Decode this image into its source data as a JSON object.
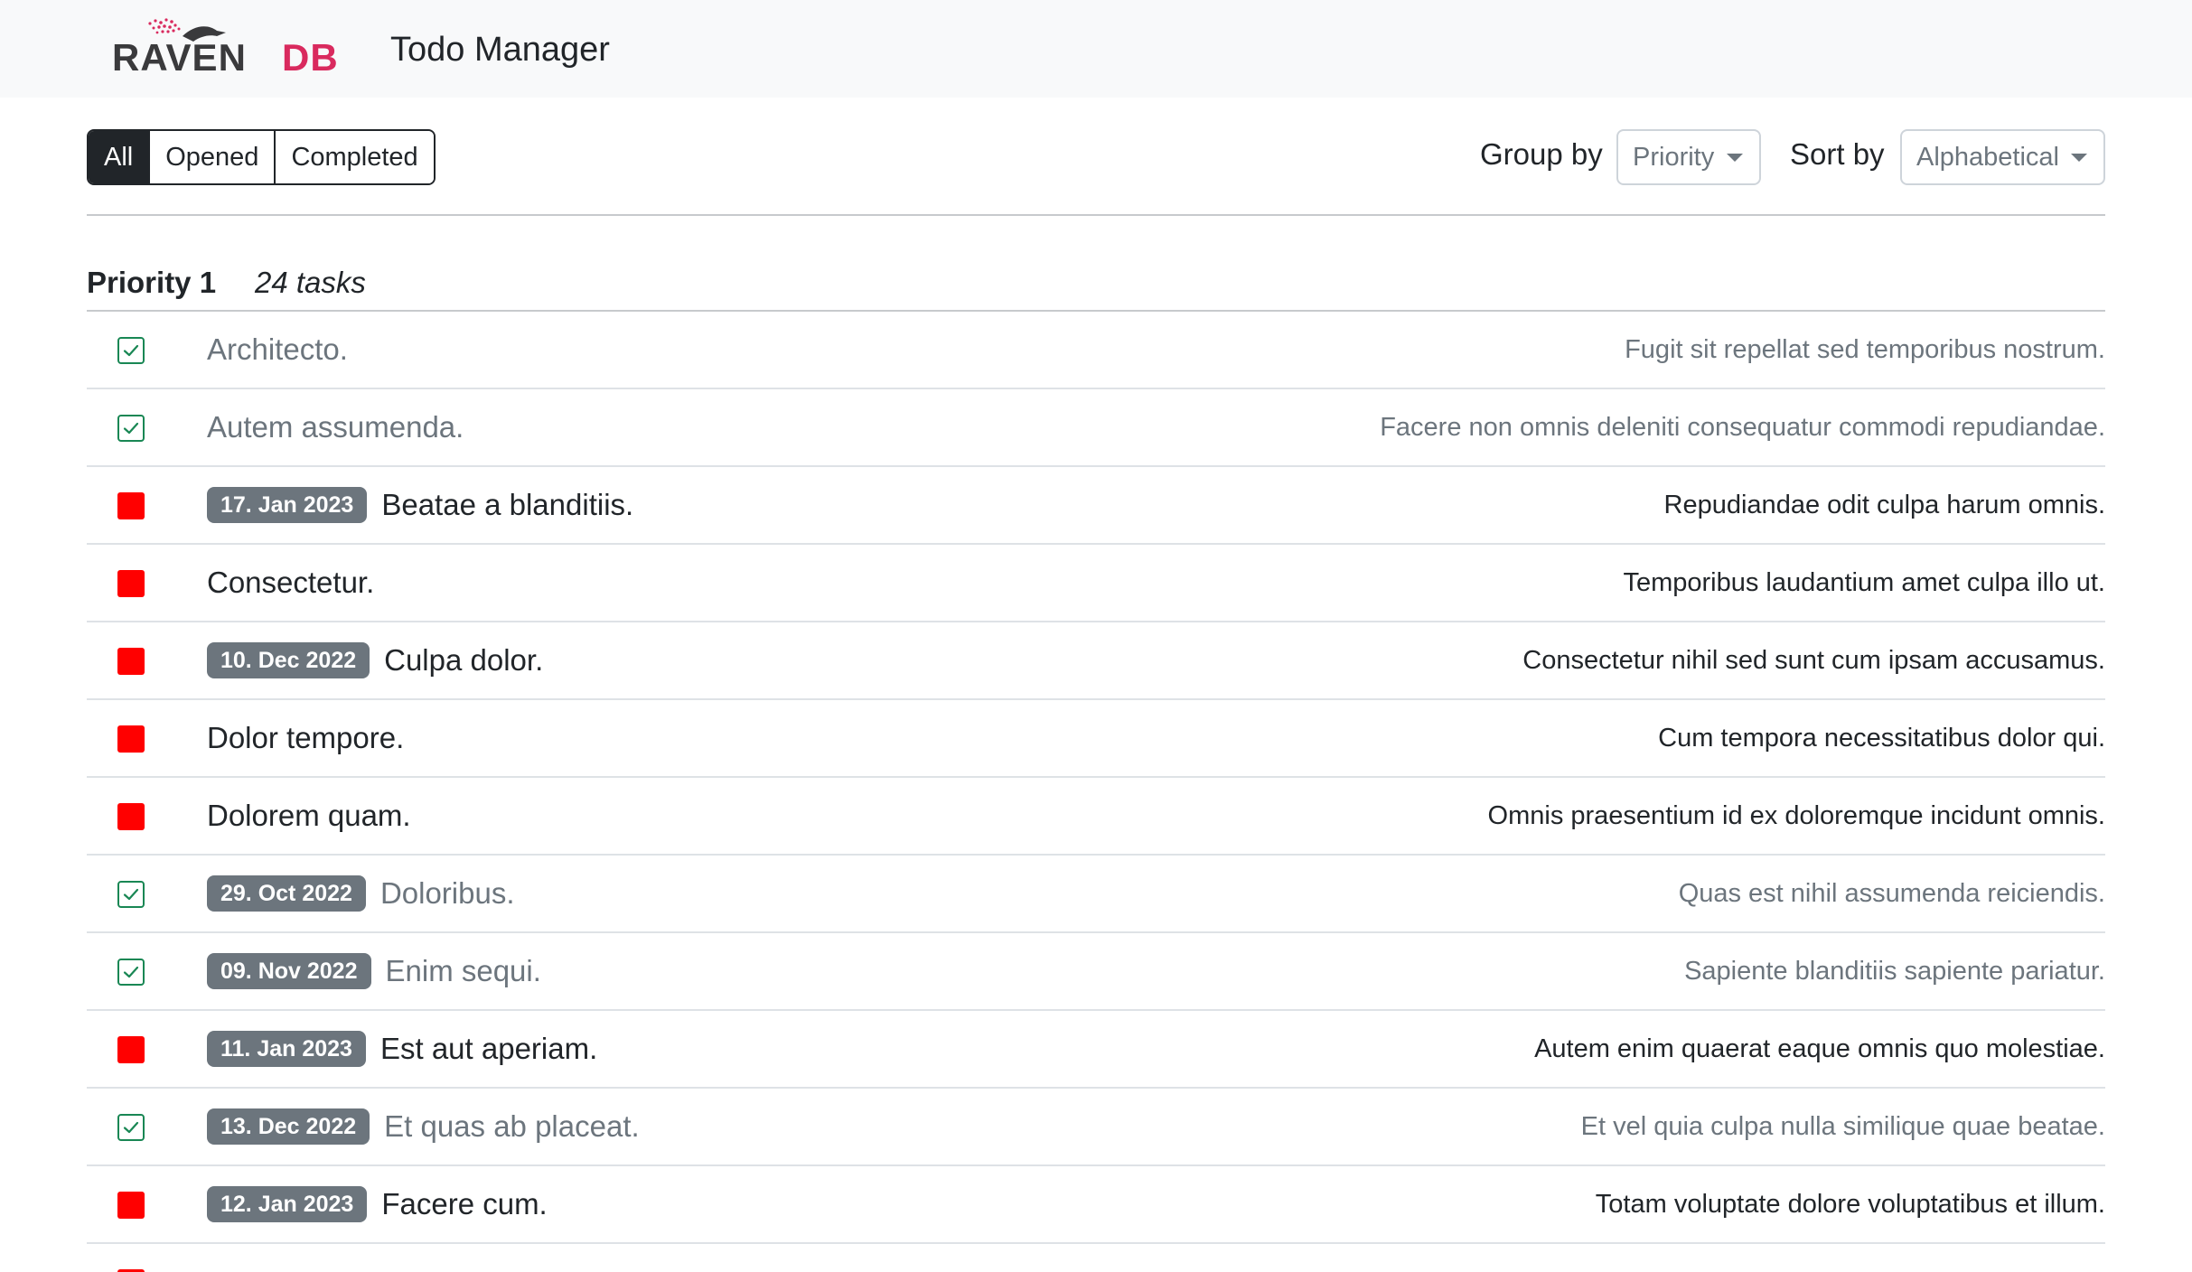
{
  "app": {
    "logo_text": "RAVENDB",
    "title": "Todo Manager"
  },
  "filters": {
    "items": [
      {
        "label": "All",
        "active": true
      },
      {
        "label": "Opened",
        "active": false
      },
      {
        "label": "Completed",
        "active": false
      }
    ]
  },
  "controls": {
    "group_by_label": "Group by",
    "group_by_value": "Priority",
    "sort_by_label": "Sort by",
    "sort_by_value": "Alphabetical"
  },
  "groups": [
    {
      "title": "Priority 1",
      "count_text": "24 tasks",
      "tasks": [
        {
          "completed": true,
          "date": "",
          "title": "Architecto.",
          "description": "Fugit sit repellat sed temporibus nostrum."
        },
        {
          "completed": true,
          "date": "",
          "title": "Autem assumenda.",
          "description": "Facere non omnis deleniti consequatur commodi repudiandae."
        },
        {
          "completed": false,
          "date": "17. Jan 2023",
          "title": "Beatae a blanditiis.",
          "description": "Repudiandae odit culpa harum omnis."
        },
        {
          "completed": false,
          "date": "",
          "title": "Consectetur.",
          "description": "Temporibus laudantium amet culpa illo ut."
        },
        {
          "completed": false,
          "date": "10. Dec 2022",
          "title": "Culpa dolor.",
          "description": "Consectetur nihil sed sunt cum ipsam accusamus."
        },
        {
          "completed": false,
          "date": "",
          "title": "Dolor tempore.",
          "description": "Cum tempora necessitatibus dolor qui."
        },
        {
          "completed": false,
          "date": "",
          "title": "Dolorem quam.",
          "description": "Omnis praesentium id ex doloremque incidunt omnis."
        },
        {
          "completed": true,
          "date": "29. Oct 2022",
          "title": "Doloribus.",
          "description": "Quas est nihil assumenda reiciendis."
        },
        {
          "completed": true,
          "date": "09. Nov 2022",
          "title": "Enim sequi.",
          "description": "Sapiente blanditiis sapiente pariatur."
        },
        {
          "completed": false,
          "date": "11. Jan 2023",
          "title": "Est aut aperiam.",
          "description": "Autem enim quaerat eaque omnis quo molestiae."
        },
        {
          "completed": true,
          "date": "13. Dec 2022",
          "title": "Et quas ab placeat.",
          "description": "Et vel quia culpa nulla similique quae beatae."
        },
        {
          "completed": false,
          "date": "12. Jan 2023",
          "title": "Facere cum.",
          "description": "Totam voluptate dolore voluptatibus et illum."
        },
        {
          "completed": false,
          "date": "",
          "title": "",
          "description": ""
        }
      ]
    }
  ],
  "colors": {
    "open_status": "#ff0000",
    "done_status": "#198754",
    "badge": "#6c757d",
    "logo_dark": "#3a3a3c",
    "logo_accent": "#d92a5e"
  }
}
